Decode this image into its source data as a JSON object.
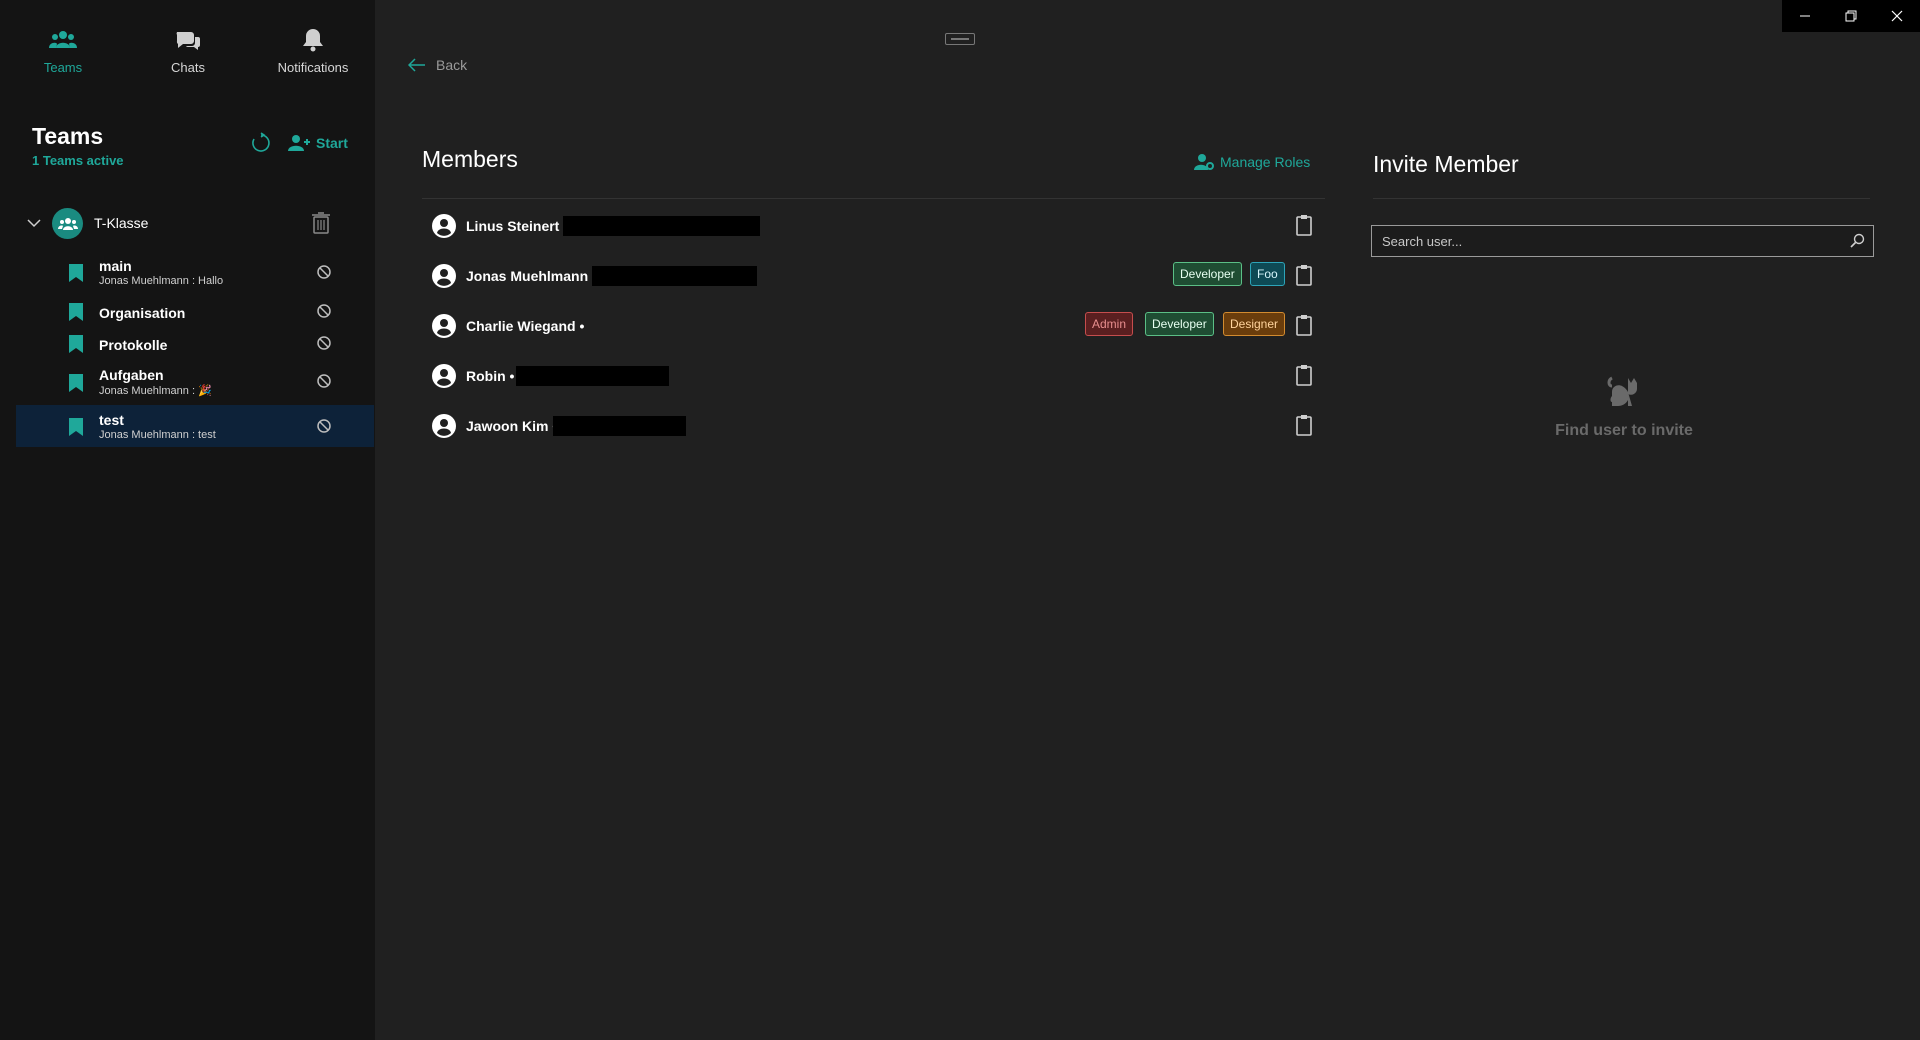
{
  "nav": {
    "teams_label": "Teams",
    "chats_label": "Chats",
    "notifications_label": "Notifications"
  },
  "sidebar": {
    "title": "Teams",
    "subtitle": "1 Teams active",
    "start_label": "Start",
    "team": {
      "name": "T-Klasse"
    },
    "channels": [
      {
        "name": "main",
        "last_message": "Jonas Muehlmann : Hallo"
      },
      {
        "name": "Organisation",
        "last_message": ""
      },
      {
        "name": "Protokolle",
        "last_message": ""
      },
      {
        "name": "Aufgaben",
        "last_message": "Jonas Muehlmann : 🎉"
      },
      {
        "name": "test",
        "last_message": "Jonas Muehlmann : test"
      }
    ]
  },
  "main": {
    "back_label": "Back",
    "members_title": "Members",
    "manage_roles_label": "Manage Roles",
    "members": [
      {
        "name": "Linus Steinert •",
        "roles": []
      },
      {
        "name": "Jonas Muehlmann •",
        "roles": [
          "Developer",
          "Foo"
        ]
      },
      {
        "name": "Charlie Wiegand •",
        "roles": [
          "Admin",
          "Developer",
          "Designer"
        ]
      },
      {
        "name": "Robin •",
        "roles": []
      },
      {
        "name": "Jawoon Kim •",
        "roles": []
      }
    ]
  },
  "invite": {
    "title": "Invite Member",
    "search_placeholder": "Search user...",
    "empty_text": "Find user to invite"
  },
  "colors": {
    "accent": "#1fa89a",
    "sidebar_bg": "#141414",
    "main_bg": "#202020",
    "selected_bg": "#0d2239"
  },
  "window_controls": [
    "minimize",
    "restore",
    "close"
  ]
}
